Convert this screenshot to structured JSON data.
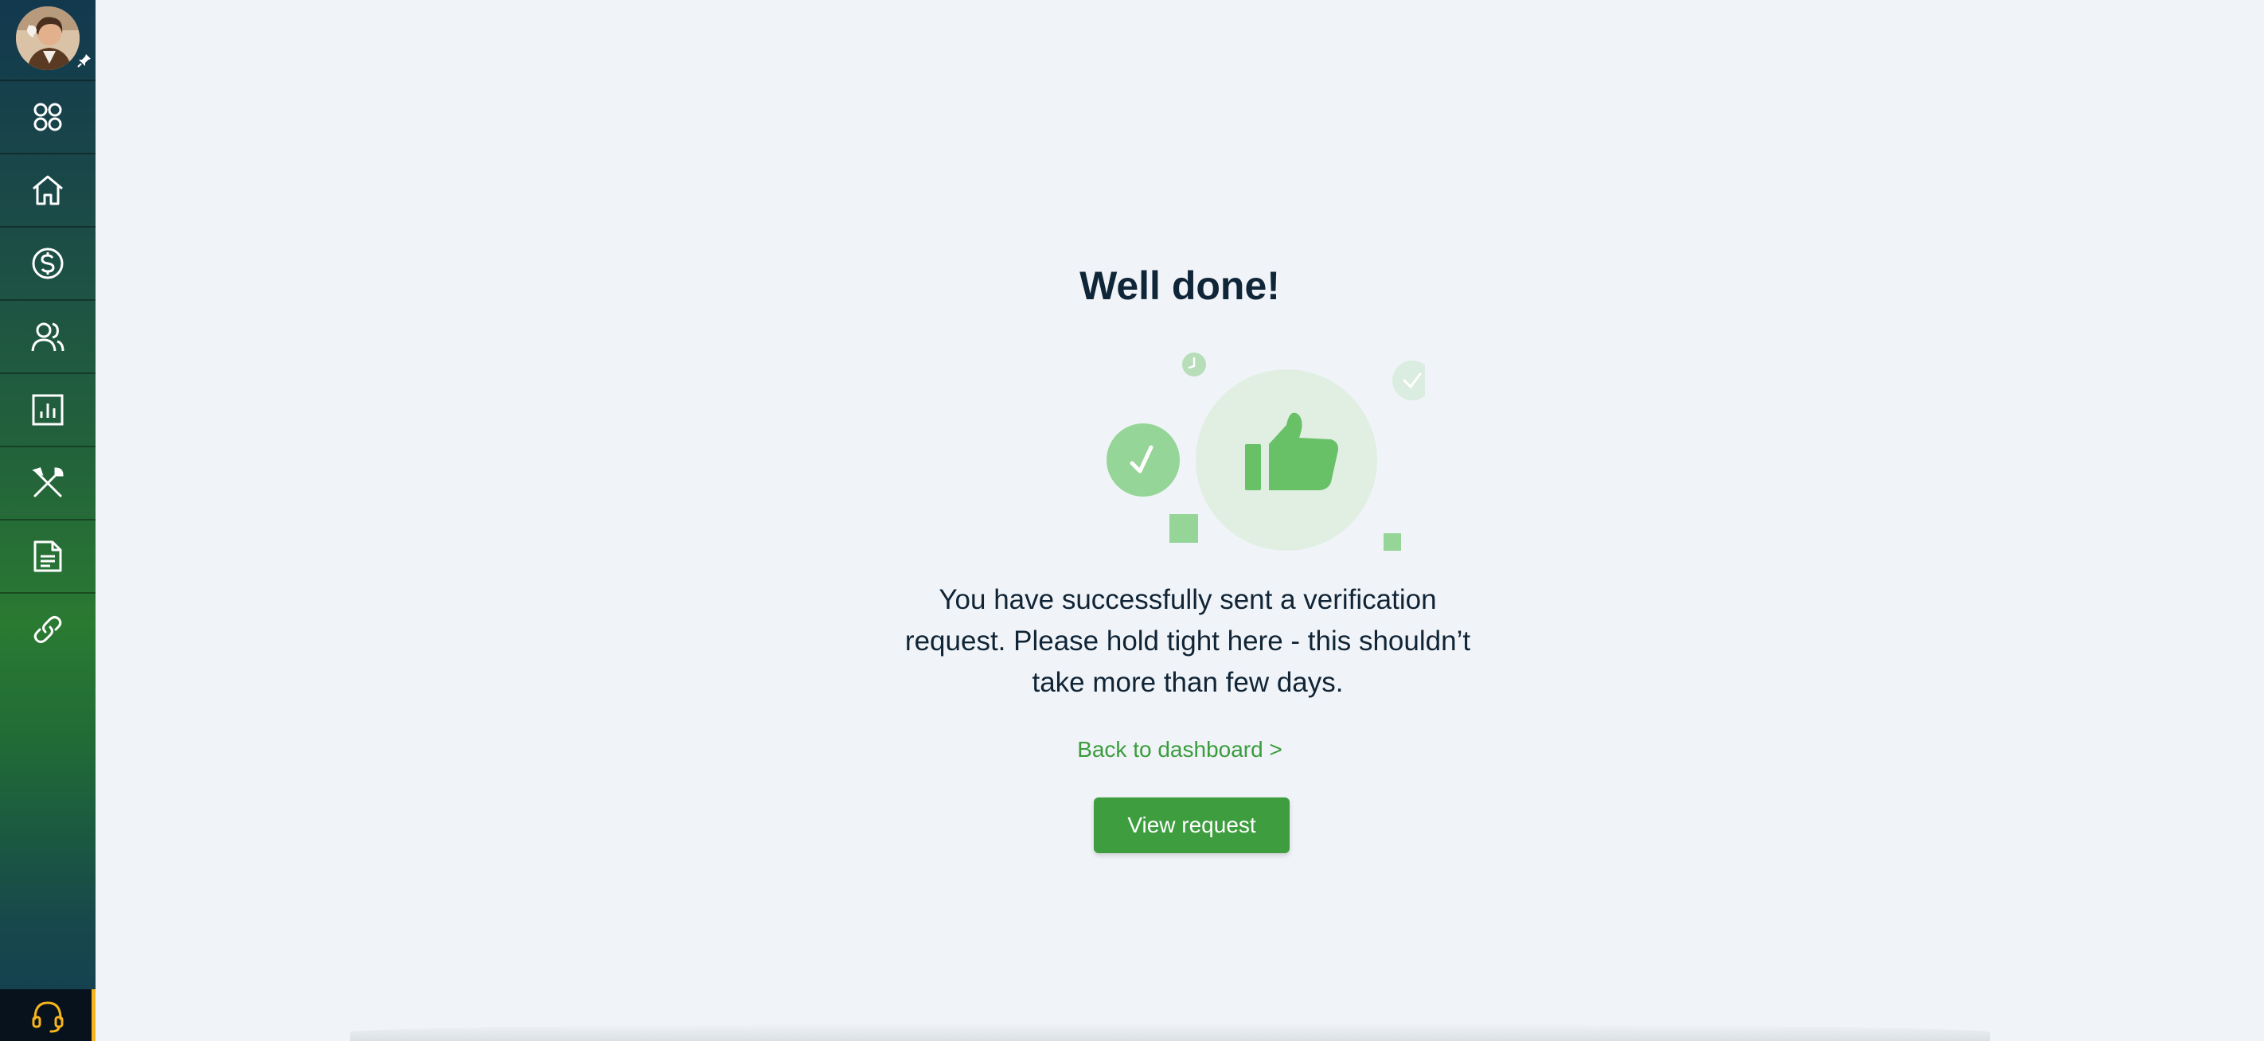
{
  "sidebar": {
    "avatar_alt": "User avatar",
    "items": [
      {
        "name": "apps",
        "icon": "apps-grid-icon"
      },
      {
        "name": "home",
        "icon": "home-icon"
      },
      {
        "name": "payments",
        "icon": "dollar-circle-icon"
      },
      {
        "name": "users",
        "icon": "users-icon"
      },
      {
        "name": "reports",
        "icon": "bar-chart-icon"
      },
      {
        "name": "tools",
        "icon": "tools-icon"
      },
      {
        "name": "documents",
        "icon": "document-icon"
      },
      {
        "name": "links",
        "icon": "link-icon"
      }
    ],
    "support_icon": "headset-icon"
  },
  "main": {
    "title": "Well done!",
    "message": "You have successfully sent a verification request. Please hold tight here - this shouldn’t take more than few days.",
    "back_link": "Back to dashboard >",
    "view_button": "View request"
  },
  "colors": {
    "accent": "#3e9d3e",
    "link": "#3a9c3c",
    "title": "#0f2538",
    "background": "#f0f4f8",
    "support_accent": "#f6b51d"
  }
}
